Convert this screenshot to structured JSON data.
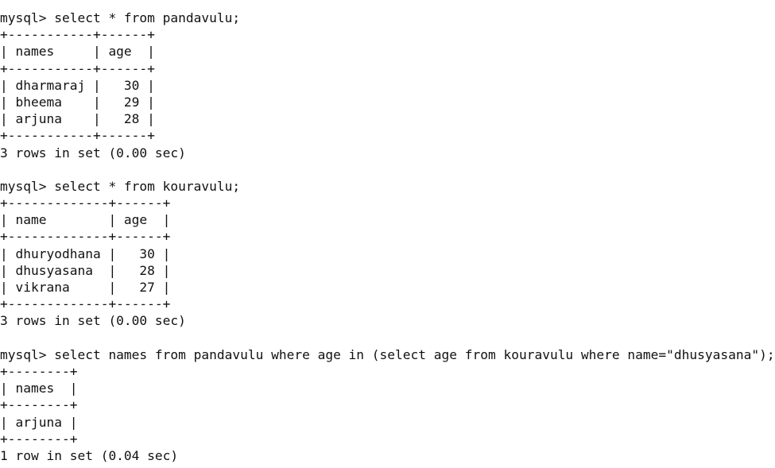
{
  "terminal": {
    "lines": [
      "mysql> select * from pandavulu;",
      "+-----------+------+",
      "| names     | age  |",
      "+-----------+------+",
      "| dharmaraj |   30 |",
      "| bheema    |   29 |",
      "| arjuna    |   28 |",
      "+-----------+------+",
      "3 rows in set (0.00 sec)",
      "",
      "mysql> select * from kouravulu;",
      "+-------------+------+",
      "| name        | age  |",
      "+-------------+------+",
      "| dhuryodhana |   30 |",
      "| dhusyasana  |   28 |",
      "| vikrana     |   27 |",
      "+-------------+------+",
      "3 rows in set (0.00 sec)",
      "",
      "mysql> select names from pandavulu where age in (select age from kouravulu where name=\"dhusyasana\");",
      "+--------+",
      "| names  |",
      "+--------+",
      "| arjuna |",
      "+--------+",
      "1 row in set (0.04 sec)"
    ]
  }
}
